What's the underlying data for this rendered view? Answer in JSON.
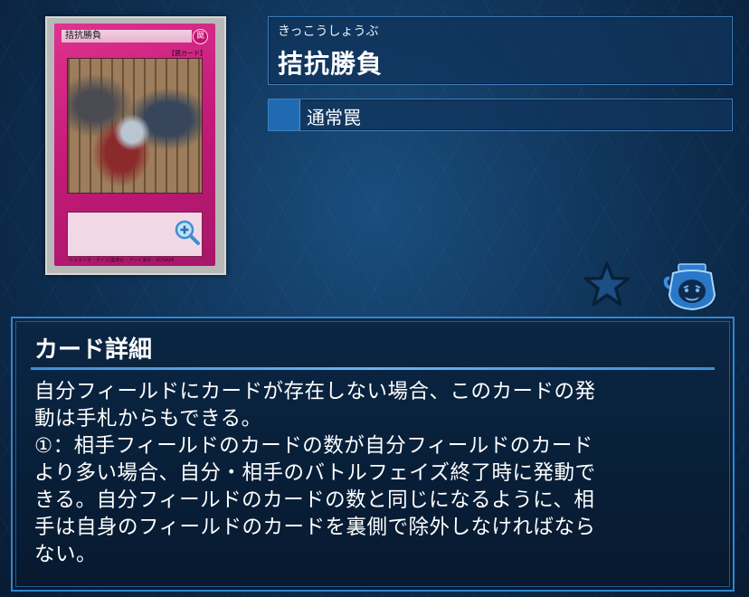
{
  "card": {
    "name": "拮抗勝負",
    "furigana": "きっこうしょうぶ",
    "attribute_glyph": "罠",
    "frame_type_label": "【罠カード】",
    "type": "通常罠",
    "copyright": "©スタジオ・ダイス/集英社・テレビ東京・KONAMI",
    "colors": {
      "frame": "#c21a77",
      "panel_border": "#3f7fbf",
      "accent": "#1f6ab0"
    }
  },
  "icons": {
    "zoom": "zoom-in-icon",
    "favorite": "star-icon",
    "pot": "pot-of-greed-icon"
  },
  "details": {
    "title": "カード詳細",
    "text": "自分フィールドにカードが存在しない場合、このカードの発\n動は手札からもできる。\n①：相手フィールドのカードの数が自分フィールドのカード\nより多い場合、自分・相手のバトルフェイズ終了時に発動で\nきる。自分フィールドのカードの数と同じになるように、相\n手は自身のフィールドのカードを裏側で除外しなければなら\nない。"
  }
}
